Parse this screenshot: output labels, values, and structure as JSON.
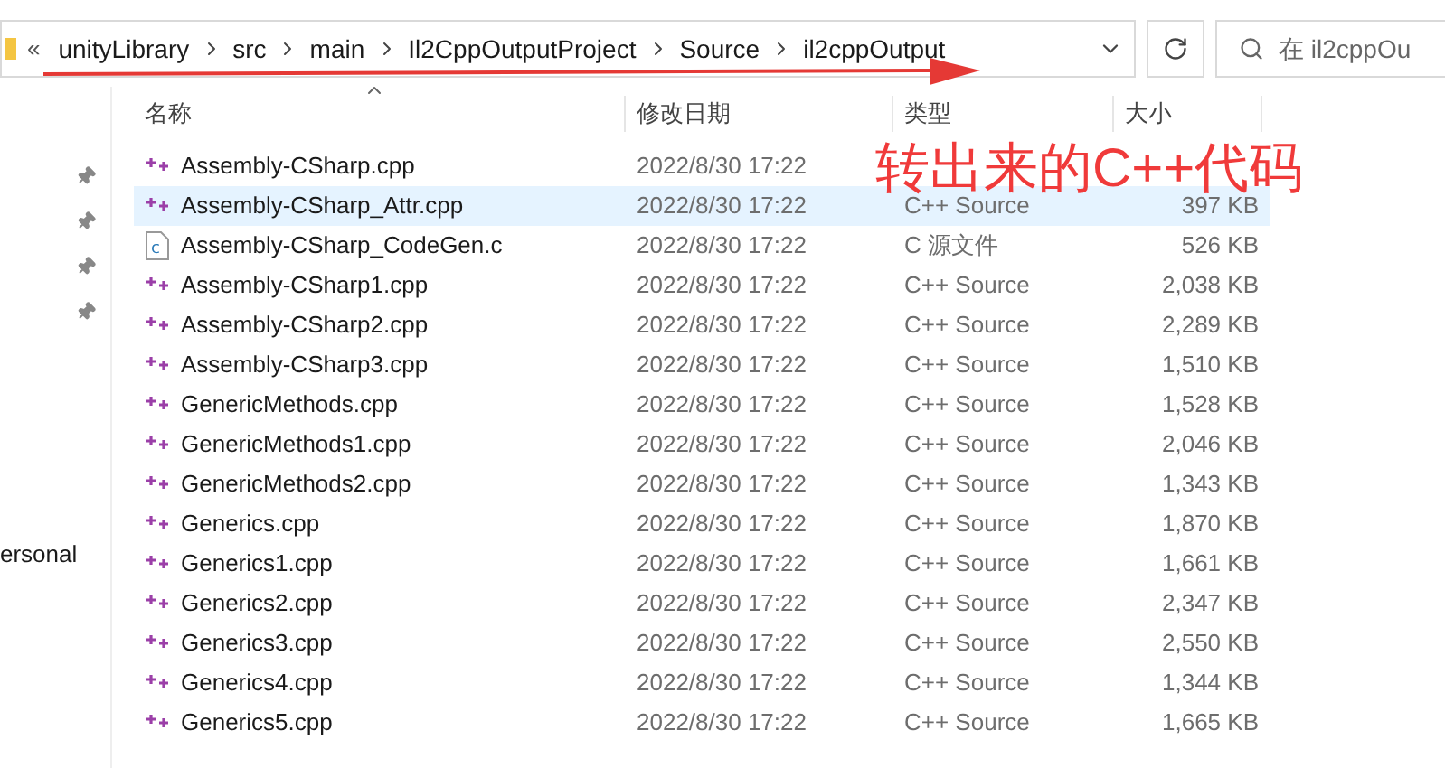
{
  "address_bar": {
    "overflow": "«",
    "path": [
      "unityLibrary",
      "src",
      "main",
      "Il2CppOutputProject",
      "Source",
      "il2cppOutput"
    ]
  },
  "search": {
    "placeholder": "在 il2cppOu"
  },
  "sidebar": {
    "items": [
      "ersonal"
    ]
  },
  "table": {
    "columns": [
      "名称",
      "修改日期",
      "类型",
      "大小"
    ],
    "rows": [
      {
        "name": "Assembly-CSharp.cpp",
        "kind": "cpp",
        "date": "2022/8/30 17:22",
        "selected": false
      },
      {
        "name": "Assembly-CSharp_Attr.cpp",
        "kind": "cpp",
        "date": "2022/8/30 17:22",
        "type": "C++ Source",
        "size": "397 KB",
        "selected": true
      },
      {
        "name": "Assembly-CSharp_CodeGen.c",
        "kind": "c",
        "date": "2022/8/30 17:22",
        "type": "C 源文件",
        "size": "526 KB",
        "selected": false
      },
      {
        "name": "Assembly-CSharp1.cpp",
        "kind": "cpp",
        "date": "2022/8/30 17:22",
        "type": "C++ Source",
        "size": "2,038 KB",
        "selected": false
      },
      {
        "name": "Assembly-CSharp2.cpp",
        "kind": "cpp",
        "date": "2022/8/30 17:22",
        "type": "C++ Source",
        "size": "2,289 KB",
        "selected": false
      },
      {
        "name": "Assembly-CSharp3.cpp",
        "kind": "cpp",
        "date": "2022/8/30 17:22",
        "type": "C++ Source",
        "size": "1,510 KB",
        "selected": false
      },
      {
        "name": "GenericMethods.cpp",
        "kind": "cpp",
        "date": "2022/8/30 17:22",
        "type": "C++ Source",
        "size": "1,528 KB",
        "selected": false
      },
      {
        "name": "GenericMethods1.cpp",
        "kind": "cpp",
        "date": "2022/8/30 17:22",
        "type": "C++ Source",
        "size": "2,046 KB",
        "selected": false
      },
      {
        "name": "GenericMethods2.cpp",
        "kind": "cpp",
        "date": "2022/8/30 17:22",
        "type": "C++ Source",
        "size": "1,343 KB",
        "selected": false
      },
      {
        "name": "Generics.cpp",
        "kind": "cpp",
        "date": "2022/8/30 17:22",
        "type": "C++ Source",
        "size": "1,870 KB",
        "selected": false
      },
      {
        "name": "Generics1.cpp",
        "kind": "cpp",
        "date": "2022/8/30 17:22",
        "type": "C++ Source",
        "size": "1,661 KB",
        "selected": false
      },
      {
        "name": "Generics2.cpp",
        "kind": "cpp",
        "date": "2022/8/30 17:22",
        "type": "C++ Source",
        "size": "2,347 KB",
        "selected": false
      },
      {
        "name": "Generics3.cpp",
        "kind": "cpp",
        "date": "2022/8/30 17:22",
        "type": "C++ Source",
        "size": "2,550 KB",
        "selected": false
      },
      {
        "name": "Generics4.cpp",
        "kind": "cpp",
        "date": "2022/8/30 17:22",
        "type": "C++ Source",
        "size": "1,344 KB",
        "selected": false
      },
      {
        "name": "Generics5.cpp",
        "kind": "cpp",
        "date": "2022/8/30 17:22",
        "type": "C++ Source",
        "size": "1,665 KB",
        "selected": false
      }
    ]
  },
  "annotation": {
    "text": "转出来的C++代码"
  }
}
